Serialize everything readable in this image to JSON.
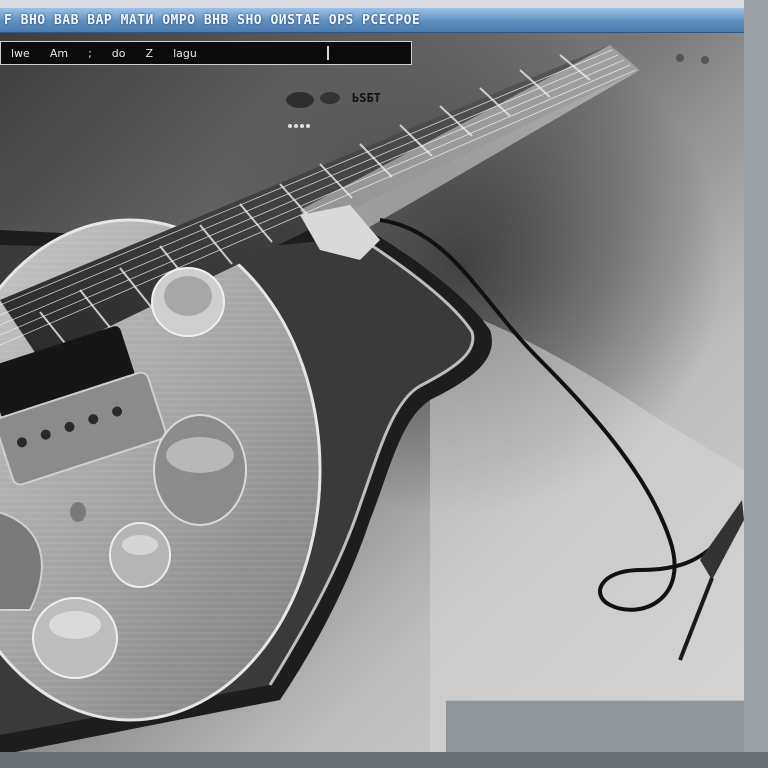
{
  "window": {
    "title": "F ВНО ВАВ ВАР МАТИ ОМРО ВНВ ЅНО ОИЅТАЕ ОРЅ РСЕСРОЕ"
  },
  "menu": {
    "items": [
      "lwe",
      "Am",
      ";",
      "do",
      "Z",
      "lagu"
    ]
  },
  "canvas": {
    "overlay_label": "ЬЅБТ"
  }
}
